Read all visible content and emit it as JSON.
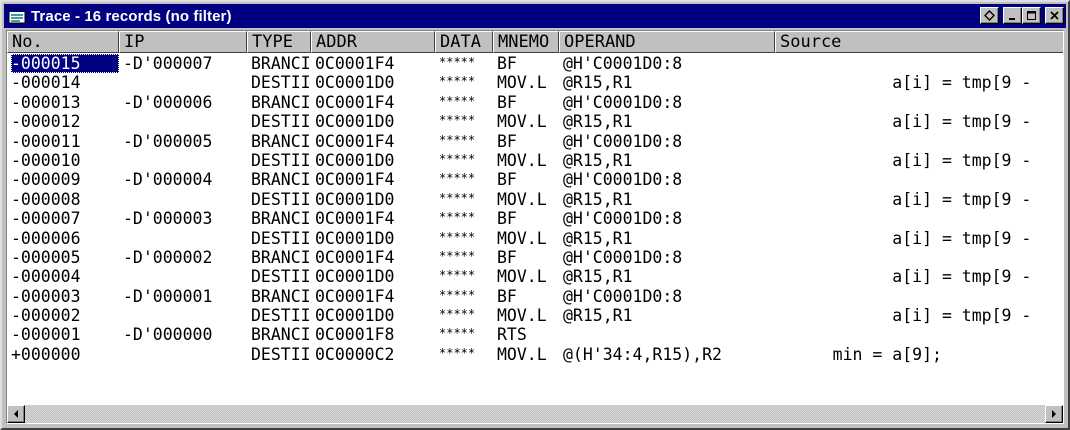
{
  "window": {
    "title": "Trace - 16 records (no filter)",
    "title_icon": "trace-list-icon",
    "buttons": [
      "restore-icon",
      "minimize-icon",
      "maximize-icon",
      "close-icon"
    ]
  },
  "colors": {
    "titlebar": "#000080",
    "face": "#c0c0c0",
    "selection": "#000080",
    "text": "#000000"
  },
  "columns": {
    "no": "No.",
    "ip": "IP",
    "type": "TYPE",
    "addr": "ADDR",
    "data": "DATA",
    "mnemo": "MNEMO",
    "operand": "OPERAND",
    "source": "Source"
  },
  "rows": [
    {
      "no": "-000015",
      "ip": "-D'000007",
      "type": "BRANCI",
      "addr": "0C0001F4",
      "data": "*****",
      "mnemo": "BF",
      "operand": "@H'C0001D0:8",
      "source": "",
      "selected": true
    },
    {
      "no": "-000014",
      "ip": "",
      "type": "DESTII",
      "addr": "0C0001D0",
      "data": "*****",
      "mnemo": "MOV.L",
      "operand": "@R15,R1",
      "source": "           a[i] = tmp[9 -"
    },
    {
      "no": "-000013",
      "ip": "-D'000006",
      "type": "BRANCI",
      "addr": "0C0001F4",
      "data": "*****",
      "mnemo": "BF",
      "operand": "@H'C0001D0:8",
      "source": ""
    },
    {
      "no": "-000012",
      "ip": "",
      "type": "DESTII",
      "addr": "0C0001D0",
      "data": "*****",
      "mnemo": "MOV.L",
      "operand": "@R15,R1",
      "source": "           a[i] = tmp[9 -"
    },
    {
      "no": "-000011",
      "ip": "-D'000005",
      "type": "BRANCI",
      "addr": "0C0001F4",
      "data": "*****",
      "mnemo": "BF",
      "operand": "@H'C0001D0:8",
      "source": ""
    },
    {
      "no": "-000010",
      "ip": "",
      "type": "DESTII",
      "addr": "0C0001D0",
      "data": "*****",
      "mnemo": "MOV.L",
      "operand": "@R15,R1",
      "source": "           a[i] = tmp[9 -"
    },
    {
      "no": "-000009",
      "ip": "-D'000004",
      "type": "BRANCI",
      "addr": "0C0001F4",
      "data": "*****",
      "mnemo": "BF",
      "operand": "@H'C0001D0:8",
      "source": ""
    },
    {
      "no": "-000008",
      "ip": "",
      "type": "DESTII",
      "addr": "0C0001D0",
      "data": "*****",
      "mnemo": "MOV.L",
      "operand": "@R15,R1",
      "source": "           a[i] = tmp[9 -"
    },
    {
      "no": "-000007",
      "ip": "-D'000003",
      "type": "BRANCI",
      "addr": "0C0001F4",
      "data": "*****",
      "mnemo": "BF",
      "operand": "@H'C0001D0:8",
      "source": ""
    },
    {
      "no": "-000006",
      "ip": "",
      "type": "DESTII",
      "addr": "0C0001D0",
      "data": "*****",
      "mnemo": "MOV.L",
      "operand": "@R15,R1",
      "source": "           a[i] = tmp[9 -"
    },
    {
      "no": "-000005",
      "ip": "-D'000002",
      "type": "BRANCI",
      "addr": "0C0001F4",
      "data": "*****",
      "mnemo": "BF",
      "operand": "@H'C0001D0:8",
      "source": ""
    },
    {
      "no": "-000004",
      "ip": "",
      "type": "DESTII",
      "addr": "0C0001D0",
      "data": "*****",
      "mnemo": "MOV.L",
      "operand": "@R15,R1",
      "source": "           a[i] = tmp[9 -"
    },
    {
      "no": "-000003",
      "ip": "-D'000001",
      "type": "BRANCI",
      "addr": "0C0001F4",
      "data": "*****",
      "mnemo": "BF",
      "operand": "@H'C0001D0:8",
      "source": ""
    },
    {
      "no": "-000002",
      "ip": "",
      "type": "DESTII",
      "addr": "0C0001D0",
      "data": "*****",
      "mnemo": "MOV.L",
      "operand": "@R15,R1",
      "source": "           a[i] = tmp[9 -"
    },
    {
      "no": "-000001",
      "ip": "-D'000000",
      "type": "BRANCI",
      "addr": "0C0001F8",
      "data": "*****",
      "mnemo": "RTS",
      "operand": "",
      "source": ""
    },
    {
      "no": "+000000",
      "ip": "",
      "type": "DESTII",
      "addr": "0C0000C2",
      "data": "*****",
      "mnemo": "MOV.L",
      "operand": "@(H'34:4,R15),R2",
      "source": "     min = a[9];"
    }
  ],
  "scrollbar": {
    "left_arrow": "scroll-left-icon",
    "right_arrow": "scroll-right-icon"
  }
}
